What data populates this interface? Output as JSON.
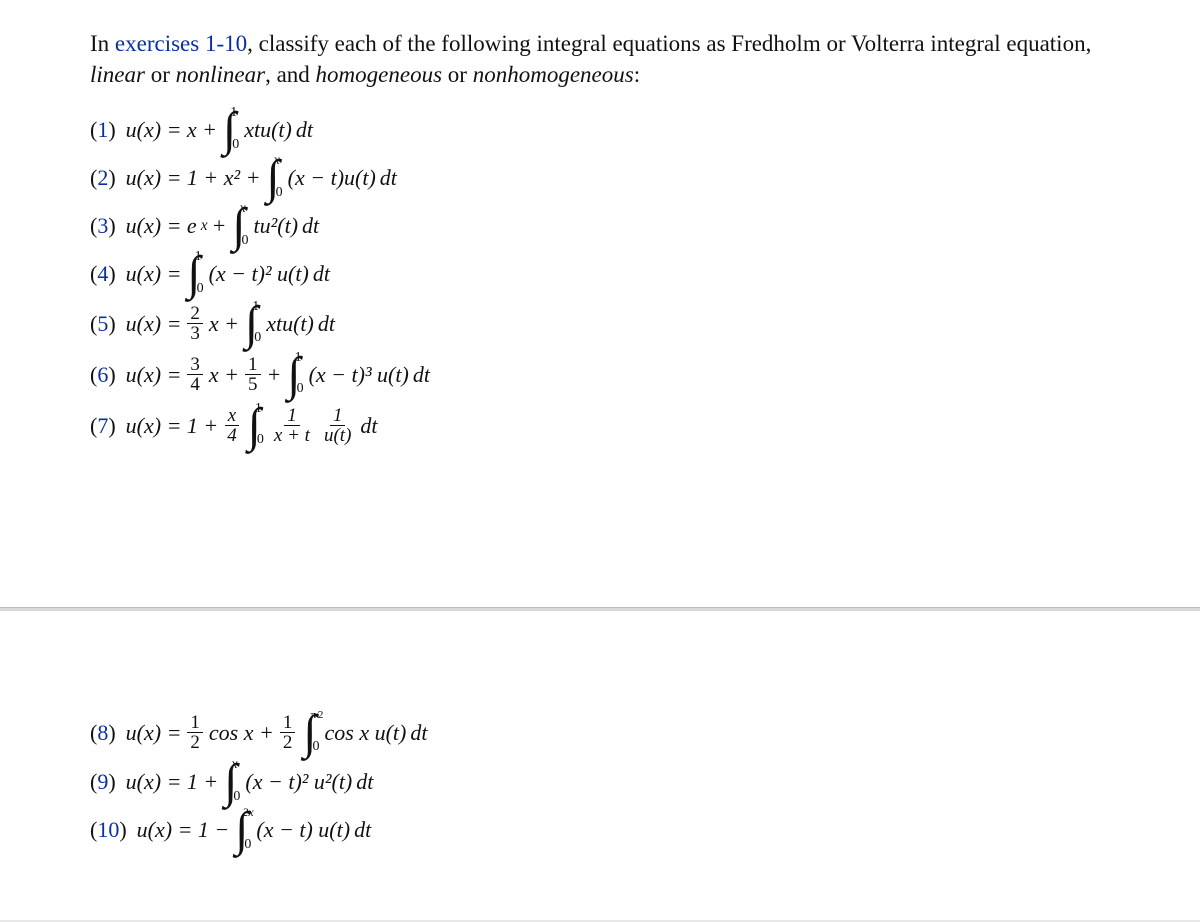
{
  "intro": {
    "lead": "In ",
    "blue1": "exercises",
    "range": " 1-10",
    "rest1": ", classify each of the following integral equations as Fredholm or Volterra integral equation, ",
    "italic1": "linear",
    "or1": " or ",
    "italic2": "nonlinear",
    "rest2": ", and ",
    "italic3": "homogeneous",
    "or2": " or ",
    "italic4": "nonhomogeneous",
    "tail": ":"
  },
  "items": [
    {
      "n": "1",
      "lhs": "u(x) = x +",
      "int_lb": "0",
      "int_ub": "1",
      "integrand_pre": "xtu(t)",
      "integrand_post": " dt"
    },
    {
      "n": "2",
      "lhs": "u(x) = 1 + x² +",
      "int_lb": "0",
      "int_ub": "x",
      "integrand_pre": "(x − t)u(t)",
      "integrand_post": " dt"
    },
    {
      "n": "3",
      "lhs_a": "u(x) = e",
      "lhs_sup": "x",
      "lhs_b": " +",
      "int_lb": "0",
      "int_ub": "x",
      "integrand_pre": "tu²(t)",
      "integrand_post": " dt"
    },
    {
      "n": "4",
      "lhs": "u(x) =",
      "int_lb": "0",
      "int_ub": "1",
      "integrand_pre": "(x − t)² u(t)",
      "integrand_post": " dt"
    },
    {
      "n": "5",
      "lhs": "u(x) =",
      "frac_num": "2",
      "frac_den": "3",
      "mid": "x +",
      "int_lb": "0",
      "int_ub": "1",
      "integrand_pre": "xtu(t)",
      "integrand_post": " dt"
    },
    {
      "n": "6",
      "lhs": "u(x) =",
      "frac_num": "3",
      "frac_den": "4",
      "mid": "x +",
      "frac2_num": "1",
      "frac2_den": "5",
      "mid2": "+",
      "int_lb": "0",
      "int_ub": "1",
      "integrand_pre": "(x − t)³ u(t)",
      "integrand_post": " dt"
    },
    {
      "n": "7",
      "lhs": "u(x) = 1 +",
      "frac_num": "x",
      "frac_den": "4",
      "int_lb": "0",
      "int_ub": "1",
      "frac2_num": "1",
      "frac2_den": "x + t",
      "frac3_num": "1",
      "frac3_den": "u(t)",
      "integrand_post": " dt"
    },
    {
      "n": "8",
      "lhs": "u(x) =",
      "frac_num": "1",
      "frac_den": "2",
      "mid": "cos x +",
      "frac2_num": "1",
      "frac2_den": "2",
      "int_lb": "0",
      "int_ub": "π⁄2",
      "integrand_pre": "cos x u(t)",
      "integrand_post": " dt"
    },
    {
      "n": "9",
      "lhs": "u(x) = 1 +",
      "int_lb": "0",
      "int_ub": "x",
      "integrand_pre": "(x − t)² u²(t)",
      "integrand_post": " dt"
    },
    {
      "n": "10",
      "lhs": "u(x) = 1 −",
      "int_lb": "0",
      "int_ub": "2x",
      "integrand_pre": "(x − t) u(t)",
      "integrand_post": " dt"
    }
  ]
}
